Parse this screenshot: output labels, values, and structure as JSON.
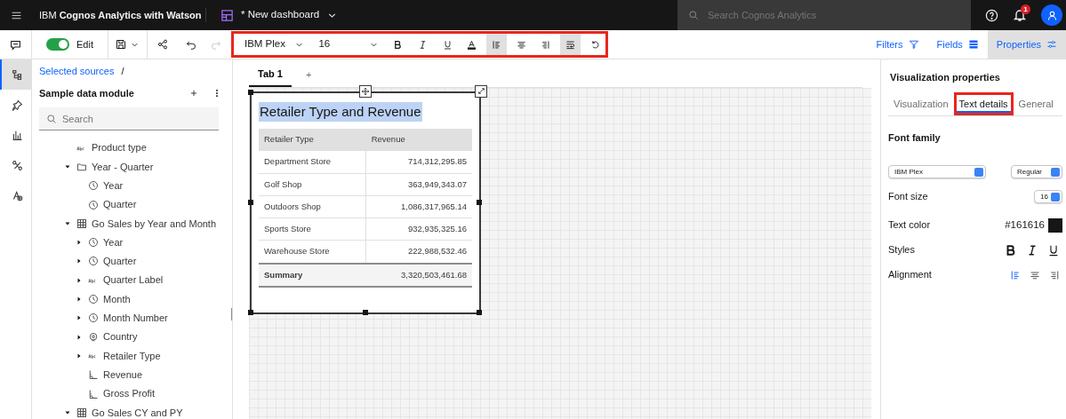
{
  "header": {
    "product": "IBM **Cognos Analytics with Watson**",
    "dashboard_title": "* New dashboard",
    "search": {
      "placeholder": "Search Cognos Analytics"
    },
    "notifications": "1"
  },
  "toolbar": {
    "edit": {
      "label": "Edit",
      "on": true
    },
    "redo_disabled": true,
    "format": {
      "highlighted": true,
      "font": "IBM Plex",
      "size": "16",
      "buttons": [
        {
          "kind": "bold",
          "selected": false
        },
        {
          "kind": "italic",
          "selected": false
        },
        {
          "kind": "underline",
          "selected": false
        },
        {
          "kind": "color",
          "selected": false
        },
        {
          "kind": "align-left",
          "selected": true
        },
        {
          "kind": "align-center",
          "selected": false
        },
        {
          "kind": "align-right",
          "selected": false
        },
        {
          "kind": "wrap",
          "selected": true
        },
        {
          "kind": "reset",
          "selected": false
        }
      ]
    },
    "panels": [
      {
        "label": "Filters",
        "kind": "filter",
        "selected": false
      },
      {
        "label": "Fields",
        "kind": "fields",
        "selected": false
      },
      {
        "label": "Properties",
        "kind": "properties",
        "selected": true
      }
    ]
  },
  "rail": [
    {
      "kind": "sources",
      "selected": true
    },
    {
      "kind": "pin",
      "selected": false
    },
    {
      "kind": "chart",
      "selected": false
    },
    {
      "kind": "relations",
      "selected": false
    },
    {
      "kind": "assistant",
      "selected": false
    }
  ],
  "sources": {
    "breadcrumb": "Selected sources",
    "separator": "/",
    "module": "Sample data module",
    "search": {
      "placeholder": "Search"
    },
    "tree": [
      {
        "label": "Product type",
        "kind": "text"
      },
      {
        "label": "Year - Quarter",
        "kind": "folder",
        "expanded": true,
        "children": [
          {
            "label": "Year",
            "kind": "time"
          },
          {
            "label": "Quarter",
            "kind": "time"
          }
        ]
      },
      {
        "label": "Go Sales by Year and Month",
        "kind": "table",
        "expanded": true,
        "children": [
          {
            "label": "Year",
            "kind": "time",
            "expanded": false
          },
          {
            "label": "Quarter",
            "kind": "time",
            "expanded": false
          },
          {
            "label": "Quarter Label",
            "kind": "text",
            "expanded": false
          },
          {
            "label": "Month",
            "kind": "time",
            "expanded": false
          },
          {
            "label": "Month Number",
            "kind": "time",
            "expanded": false
          },
          {
            "label": "Country",
            "kind": "location",
            "expanded": false
          },
          {
            "label": "Retailer Type",
            "kind": "text",
            "expanded": false
          },
          {
            "label": "Revenue",
            "kind": "measure"
          },
          {
            "label": "Gross Profit",
            "kind": "measure"
          }
        ]
      },
      {
        "label": "Go Sales CY and PY",
        "kind": "table",
        "expanded": true
      }
    ]
  },
  "canvas": {
    "tabs": [
      {
        "label": "Tab 1",
        "selected": true
      }
    ],
    "add_tab": "+",
    "widget": {
      "title": "Retailer Type and Revenue",
      "title_selected": true,
      "columns": [
        "Retailer Type",
        "Revenue"
      ],
      "rows": [
        [
          "Department Store",
          "714,312,295.85"
        ],
        [
          "Golf Shop",
          "363,949,343.07"
        ],
        [
          "Outdoors Shop",
          "1,086,317,965.14"
        ],
        [
          "Sports Store",
          "932,935,325.16"
        ],
        [
          "Warehouse Store",
          "222,988,532.46"
        ]
      ],
      "summary": [
        "Summary",
        "3,320,503,461.68"
      ]
    }
  },
  "properties": {
    "title": "Visualization properties",
    "tabs": [
      {
        "label": "Visualization",
        "selected": false,
        "highlighted": false
      },
      {
        "label": "Text details",
        "selected": true,
        "highlighted": true
      },
      {
        "label": "General",
        "selected": false,
        "highlighted": false
      }
    ],
    "section": "Font family",
    "font_family": "IBM Plex",
    "font_weight": "Regular",
    "font_size_label": "Font size",
    "font_size": "16",
    "text_color_label": "Text color",
    "text_color": "#161616",
    "styles_label": "Styles",
    "styles": [
      {
        "kind": "bold",
        "selected": false
      },
      {
        "kind": "italic",
        "selected": false
      },
      {
        "kind": "underline",
        "selected": false
      }
    ],
    "alignment_label": "Alignment",
    "alignment": [
      {
        "kind": "align-left",
        "selected": true
      },
      {
        "kind": "align-center",
        "selected": false
      },
      {
        "kind": "align-right",
        "selected": false
      }
    ]
  }
}
